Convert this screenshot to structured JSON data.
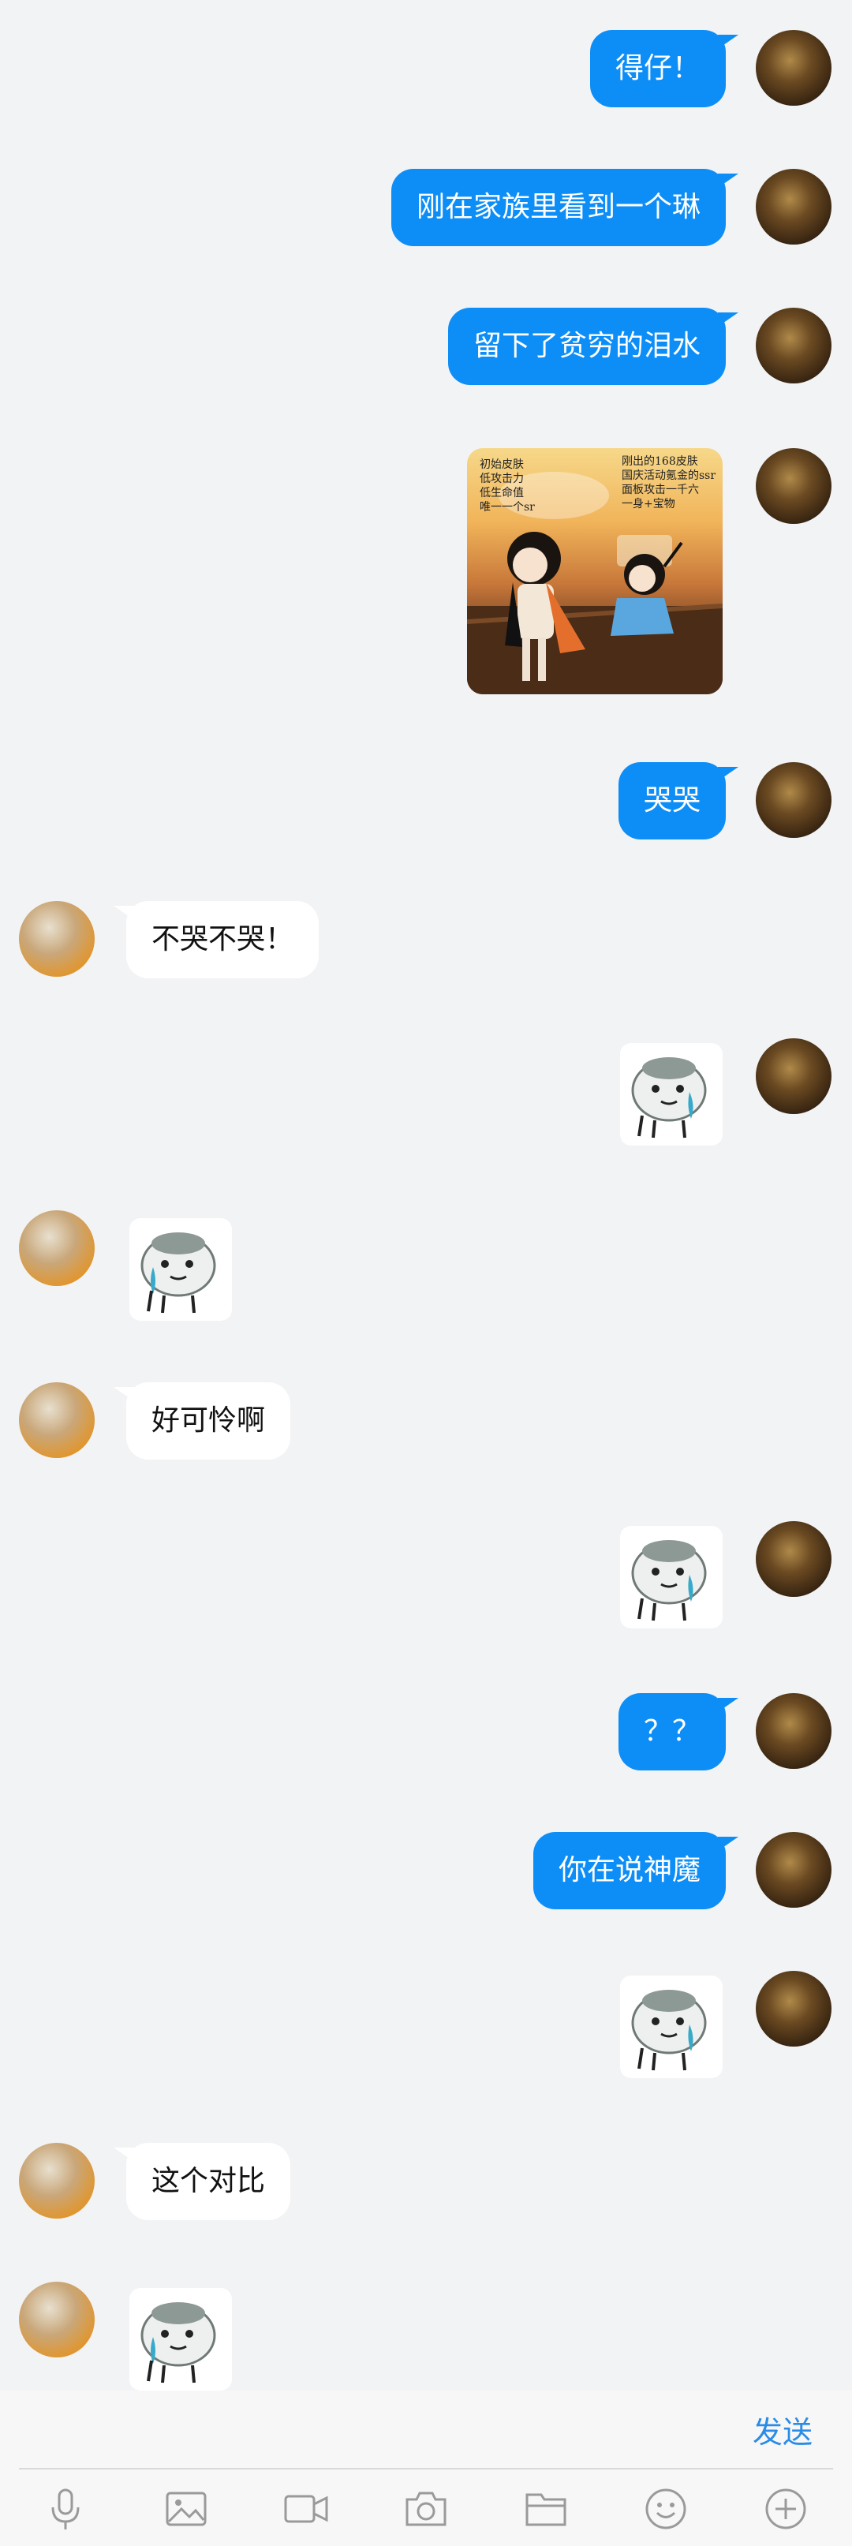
{
  "messages": [
    {
      "side": "me",
      "type": "text",
      "text": "得仔！"
    },
    {
      "side": "me",
      "type": "text",
      "text": "刚在家族里看到一个琳"
    },
    {
      "side": "me",
      "type": "text",
      "text": "留下了贫穷的泪水"
    },
    {
      "side": "me",
      "type": "image",
      "caption_left": "初始皮肤\n低攻击力\n低生命值\n唯一一个sr",
      "caption_right": "刚出的168皮肤\n国庆活动氪金的ssr\n面板攻击一千六\n一身+宝物"
    },
    {
      "side": "me",
      "type": "text",
      "text": "哭哭"
    },
    {
      "side": "other",
      "type": "text",
      "text": "不哭不哭！"
    },
    {
      "side": "me",
      "type": "sticker",
      "sticker": "hamster-crying-sticker"
    },
    {
      "side": "other",
      "type": "sticker",
      "sticker": "hamster-crying-sticker"
    },
    {
      "side": "other",
      "type": "text",
      "text": "好可怜啊"
    },
    {
      "side": "me",
      "type": "sticker",
      "sticker": "hamster-crying-sticker"
    },
    {
      "side": "me",
      "type": "text",
      "text": "？？"
    },
    {
      "side": "me",
      "type": "text",
      "text": "你在说神魔"
    },
    {
      "side": "me",
      "type": "sticker",
      "sticker": "hamster-crying-sticker"
    },
    {
      "side": "other",
      "type": "text",
      "text": "这个对比"
    },
    {
      "side": "other",
      "type": "sticker",
      "sticker": "hamster-crying-sticker"
    }
  ],
  "composer": {
    "send_label": "发送"
  },
  "toolbar": [
    {
      "name": "microphone-icon"
    },
    {
      "name": "image-icon"
    },
    {
      "name": "video-icon"
    },
    {
      "name": "camera-icon"
    },
    {
      "name": "folder-icon"
    },
    {
      "name": "emoji-icon"
    },
    {
      "name": "plus-icon"
    }
  ],
  "colors": {
    "background": "#f2f3f5",
    "my_bubble": "#0d8ef7",
    "other_bubble": "#ffffff",
    "send_text": "#2a8ce6",
    "icon_gray": "#9a9a9a"
  }
}
